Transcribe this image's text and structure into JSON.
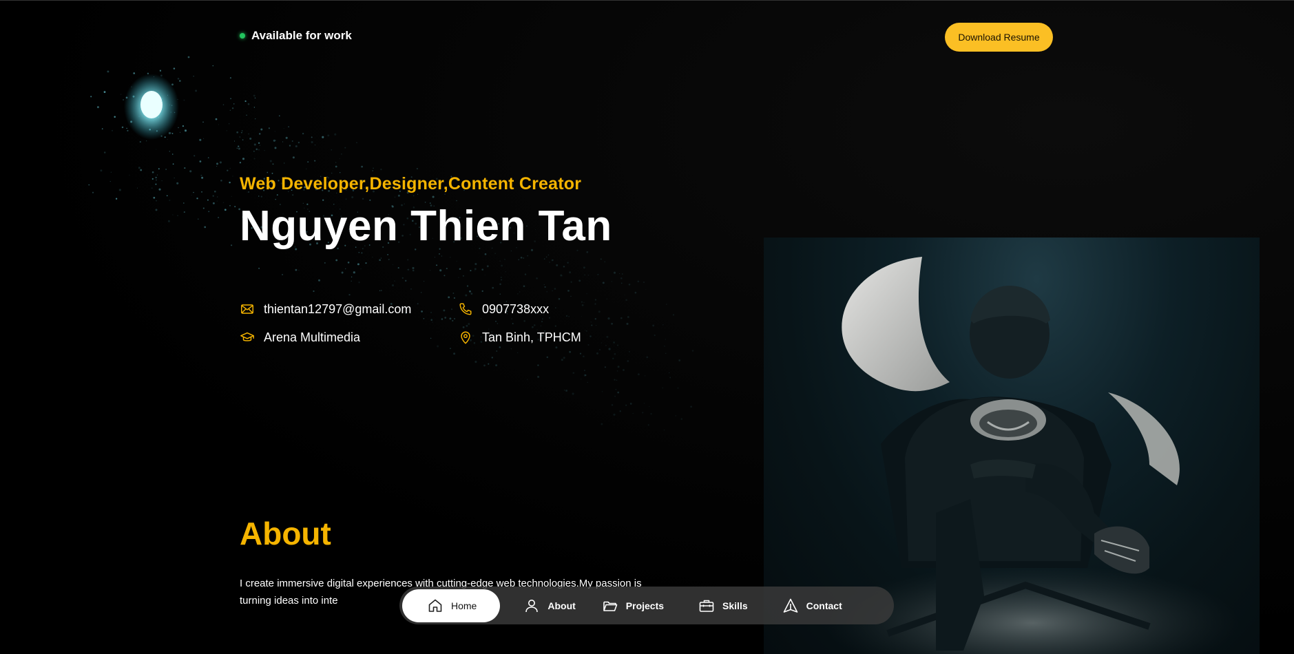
{
  "header": {
    "status_text": "Available for work",
    "status_color": "#22c55e",
    "resume_button": "Download Resume",
    "accent": "#fbbf24"
  },
  "hero": {
    "roles": "Web Developer,Designer,Content Creator",
    "name": "Nguyen Thien Tan",
    "contacts": {
      "email": "thientan12797@gmail.com",
      "phone": "0907738xxx",
      "school": "Arena Multimedia",
      "location": "Tan Binh, TPHCM"
    },
    "icons": {
      "email": "mail-icon",
      "phone": "phone-icon",
      "school": "graduation-cap-icon",
      "location": "map-pin-icon"
    }
  },
  "about": {
    "title": "About",
    "text": "I create immersive digital experiences with cutting-edge web technologies.My passion is turning ideas into inte"
  },
  "nav": {
    "items": [
      {
        "label": "Home",
        "icon": "home-icon",
        "active": true
      },
      {
        "label": "About",
        "icon": "user-icon",
        "active": false
      },
      {
        "label": "Projects",
        "icon": "folder-icon",
        "active": false
      },
      {
        "label": "Skills",
        "icon": "briefcase-icon",
        "active": false
      },
      {
        "label": "Contact",
        "icon": "send-icon",
        "active": false
      }
    ]
  }
}
